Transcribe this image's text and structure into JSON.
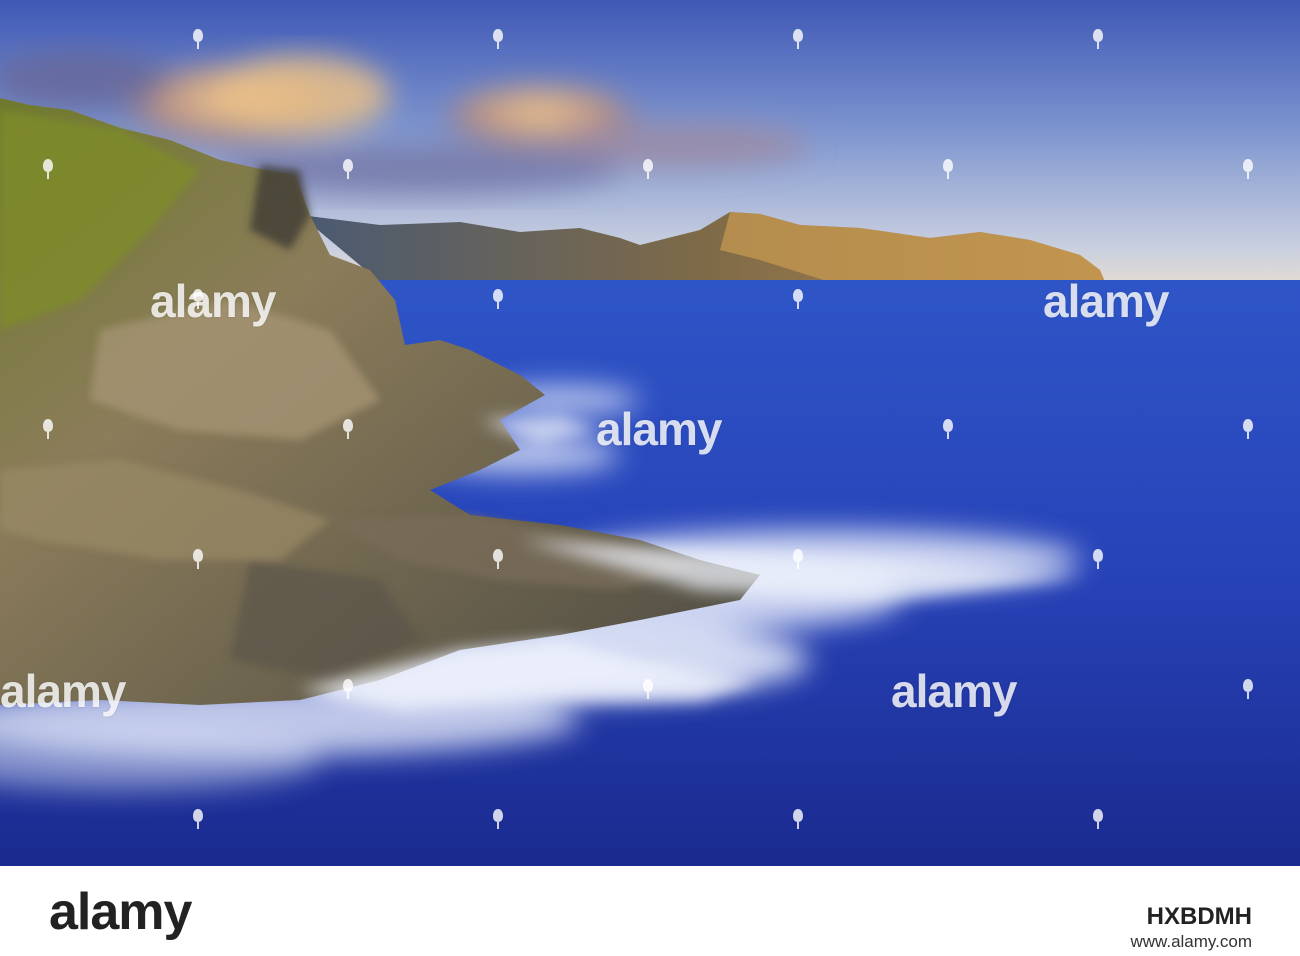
{
  "watermark": {
    "word": "alamy"
  },
  "footer": {
    "logo_text": "alamy",
    "image_id": "HXBDMH",
    "url": "www.alamy.com"
  },
  "colors": {
    "sea": "#2a3fb5",
    "sky": "#5c7ac8",
    "rock": "#8a7a5e",
    "foam": "#dde4f6",
    "footer_text": "#222222"
  }
}
